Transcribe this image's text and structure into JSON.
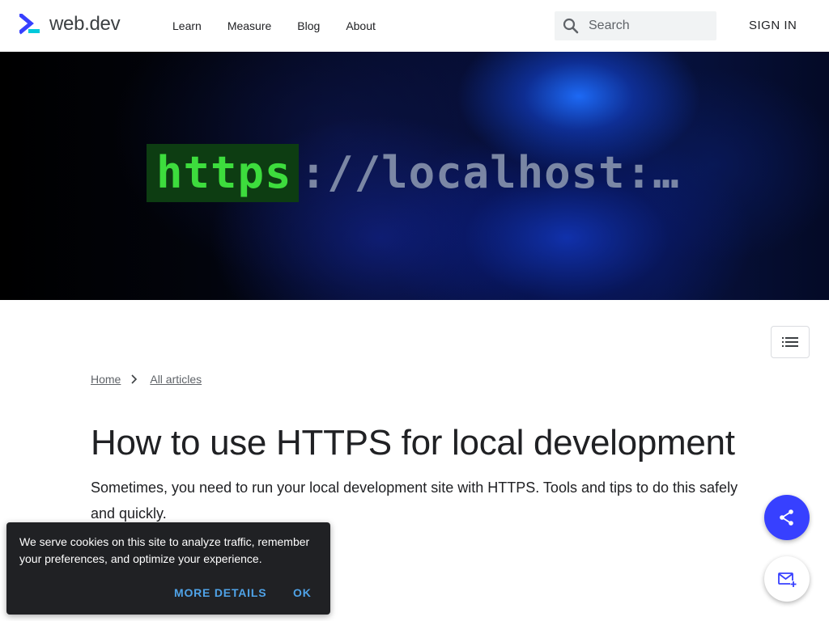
{
  "header": {
    "logo_text": "web.dev",
    "nav": [
      {
        "label": "Learn"
      },
      {
        "label": "Measure"
      },
      {
        "label": "Blog"
      },
      {
        "label": "About"
      }
    ],
    "search": {
      "placeholder": "Search",
      "icon": "search-icon"
    },
    "signin_label": "SIGN IN"
  },
  "hero": {
    "code_highlight": "https",
    "code_rest": "://localhost:…",
    "colors": {
      "highlight_bg": "#0d3d12",
      "highlight_text": "#3ddc3d",
      "rest_text": "#8f9bb3"
    }
  },
  "toc": {
    "icon": "list-icon"
  },
  "breadcrumb": {
    "items": [
      {
        "label": "Home"
      },
      {
        "label": "All articles"
      }
    ],
    "separator_icon": "chevron-right-icon"
  },
  "article": {
    "title": "How to use HTTPS for local development",
    "subtitle": "Sometimes, you need to run your local development site with HTTPS. Tools and tips to do this safely and quickly."
  },
  "fabs": {
    "share_icon": "share-icon",
    "subscribe_icon": "mail-add-icon",
    "accent": "#3740ff"
  },
  "cookie_banner": {
    "text": "We serve cookies on this site to analyze traffic, remember your preferences, and optimize your experience.",
    "more_details_label": "MORE DETAILS",
    "ok_label": "OK",
    "link_color": "#4fa3e8"
  }
}
